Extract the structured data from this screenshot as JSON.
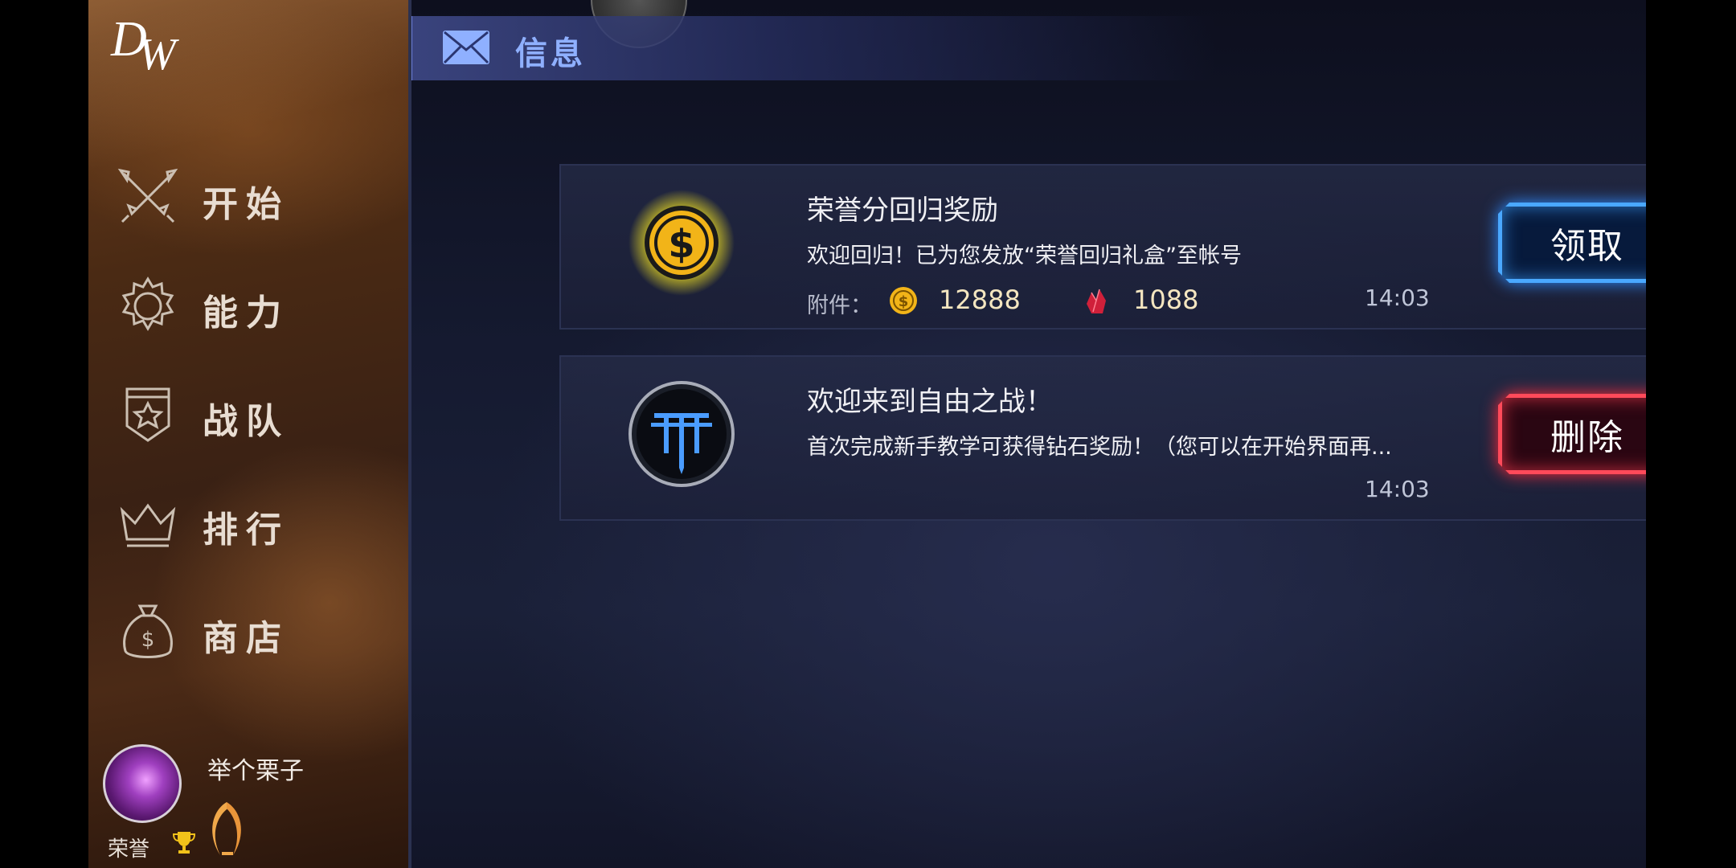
{
  "sidebar": {
    "logo": {
      "line1": "D",
      "line2": "W"
    },
    "items": [
      {
        "label": "开始",
        "icon": "crossed-swords-icon"
      },
      {
        "label": "能力",
        "icon": "gear-icon"
      },
      {
        "label": "战队",
        "icon": "shield-star-icon"
      },
      {
        "label": "排行",
        "icon": "crown-icon"
      },
      {
        "label": "商店",
        "icon": "money-bag-icon"
      }
    ],
    "profile": {
      "username": "举个栗子",
      "honor_label": "荣誉"
    }
  },
  "header": {
    "title": "信息"
  },
  "messages": [
    {
      "title": "荣誉分回归奖励",
      "text": "欢迎回归！已为您发放“荣誉回归礼盒”至帐号",
      "attachments_label": "附件：",
      "coins": "12888",
      "gems": "1088",
      "time": "14:03",
      "action": "领取"
    },
    {
      "title": "欢迎来到自由之战！",
      "text": "首次完成新手教学可获得钻石奖励！（您可以在开始界面再...",
      "time": "14:03",
      "action": "删除"
    }
  ],
  "colors": {
    "accent_blue": "#4aa8ff",
    "accent_red": "#ff4a5a",
    "header_text": "#8fb0ff",
    "gold": "#f2c21a"
  }
}
